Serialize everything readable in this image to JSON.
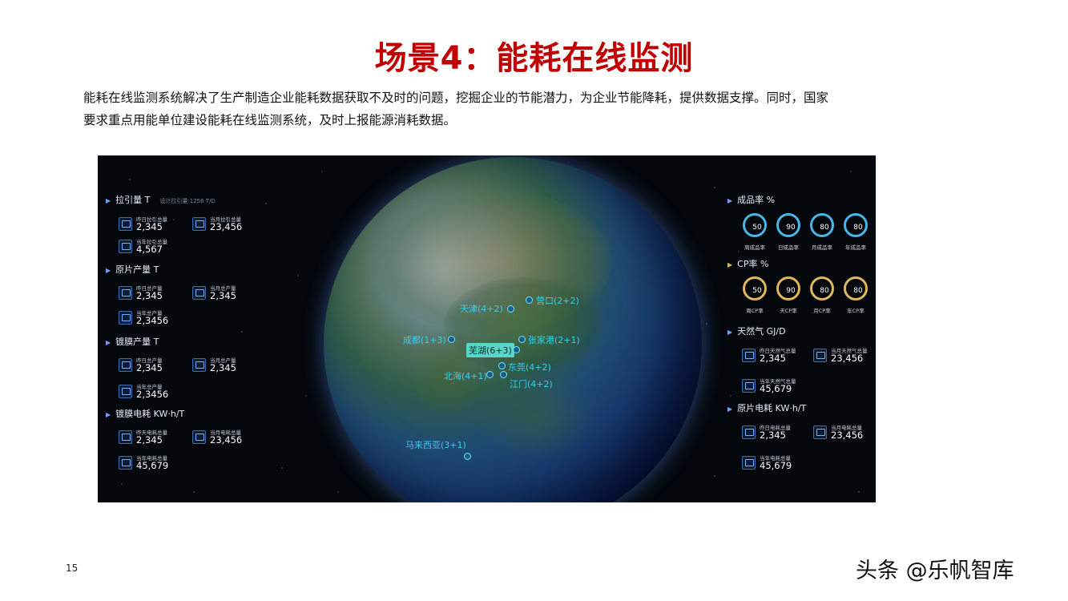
{
  "slide": {
    "title": "场景4：能耗在线监测",
    "intro_line1": "能耗在线监测系统解决了生产制造企业能耗数据获取不及时的问题，挖掘企业的节能潜力，为企业节能降耗，提供数据支撑。同时，国家",
    "intro_line2": "要求重点用能单位建设能耗在线监测系统，及时上报能源消耗数据。",
    "page_number": "15",
    "watermark": "头条 @乐帆智库"
  },
  "left": {
    "draw": {
      "title": "拉引量",
      "unit": "T",
      "subtitle": "设计拉引量:1256 T/D",
      "items": [
        {
          "label": "昨日拉引总量",
          "value": "2,345"
        },
        {
          "label": "当月拉引总量",
          "value": "23,456"
        },
        {
          "label": "当年拉引总量",
          "value": "4,567"
        }
      ]
    },
    "raw_output": {
      "title": "原片产量",
      "unit": "T",
      "items": [
        {
          "label": "昨日总产量",
          "value": "2,345"
        },
        {
          "label": "当月总产量",
          "value": "2,345"
        },
        {
          "label": "当年总产量",
          "value": "2,3456"
        }
      ]
    },
    "coating_output": {
      "title": "镀膜产量",
      "unit": "T",
      "items": [
        {
          "label": "昨日总产量",
          "value": "2,345"
        },
        {
          "label": "当月总产量",
          "value": "2,345"
        },
        {
          "label": "当年总产量",
          "value": "2,3456"
        }
      ]
    },
    "coating_power": {
      "title": "镀膜电耗",
      "unit": "KW·h/T",
      "items": [
        {
          "label": "昨天电耗总量",
          "value": "2,345"
        },
        {
          "label": "当月电耗总量",
          "value": "23,456"
        },
        {
          "label": "当年电耗总量",
          "value": "45,679"
        }
      ]
    }
  },
  "right": {
    "yield": {
      "title": "成品率",
      "unit": "%",
      "color": "#49b6e8",
      "gauges": [
        {
          "value": "50",
          "label": "周成品率"
        },
        {
          "value": "90",
          "label": "日成品率"
        },
        {
          "value": "80",
          "label": "月成品率"
        },
        {
          "value": "80",
          "label": "年成品率"
        }
      ]
    },
    "cp": {
      "title": "CP率",
      "unit": "%",
      "color": "#e0b75c",
      "gauges": [
        {
          "value": "50",
          "label": "周CP率"
        },
        {
          "value": "90",
          "label": "天CP率"
        },
        {
          "value": "80",
          "label": "月CP率"
        },
        {
          "value": "80",
          "label": "年CP率"
        }
      ]
    },
    "gas": {
      "title": "天然气",
      "unit": "GJ/D",
      "items": [
        {
          "label": "昨日天然气总量",
          "value": "2,345"
        },
        {
          "label": "当月天然气总量",
          "value": "23,456"
        },
        {
          "label": "当年天然气总量",
          "value": "45,679"
        }
      ]
    },
    "raw_power": {
      "title": "原片电耗",
      "unit": "KW·h/T",
      "items": [
        {
          "label": "昨日电耗总量",
          "value": "2,345"
        },
        {
          "label": "当月电耗总量",
          "value": "23,456"
        },
        {
          "label": "当年电耗总量",
          "value": "45,679"
        }
      ]
    }
  },
  "map": {
    "cities": [
      {
        "name": "营口(2+2)"
      },
      {
        "name": "天津(4+2)"
      },
      {
        "name": "成都(1+3)"
      },
      {
        "name": "张家港(2+1)"
      },
      {
        "name": "芜湖(6+3)"
      },
      {
        "name": "东莞(4+2)"
      },
      {
        "name": "北海(4+1)"
      },
      {
        "name": "江门(4+2)"
      },
      {
        "name": "马来西亚(3+1)"
      }
    ]
  }
}
